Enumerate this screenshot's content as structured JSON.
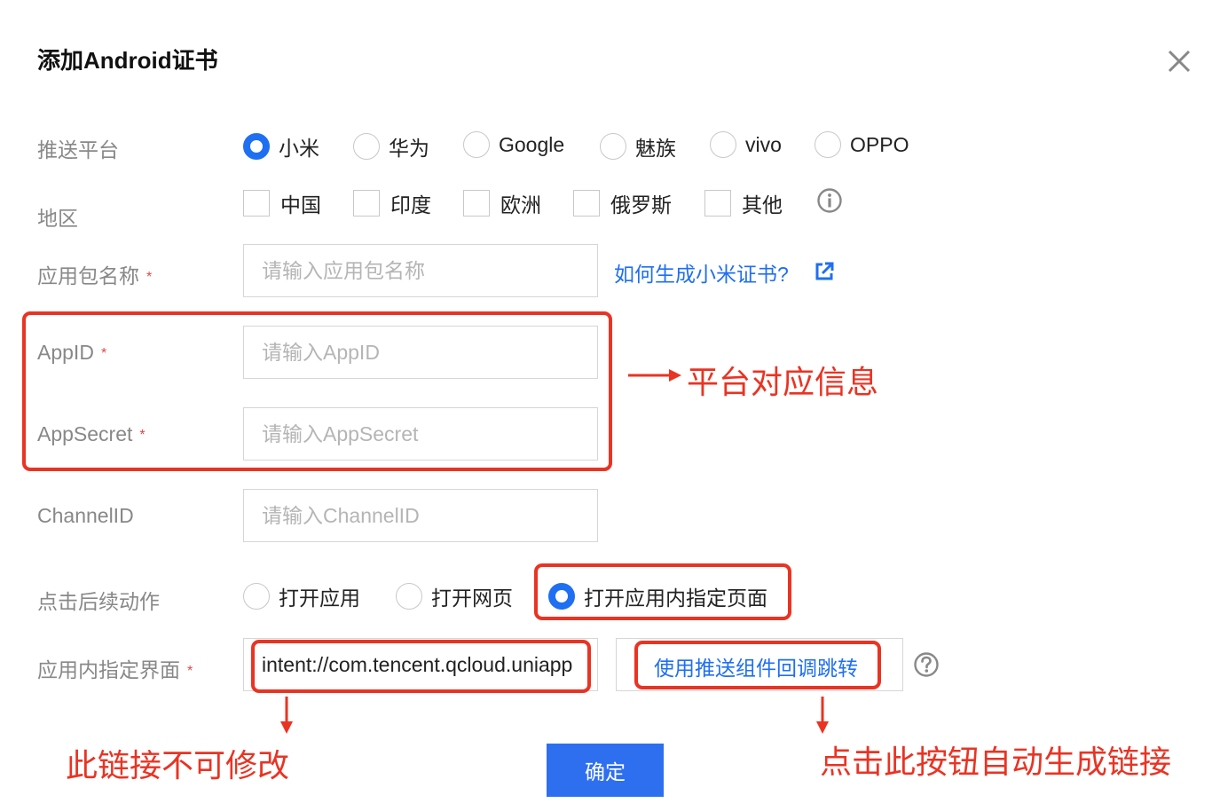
{
  "dialog": {
    "title": "添加Android证书",
    "close_icon": "close-icon"
  },
  "form": {
    "platform": {
      "label": "推送平台",
      "options": [
        "小米",
        "华为",
        "Google",
        "魅族",
        "vivo",
        "OPPO"
      ],
      "selected": "小米"
    },
    "region": {
      "label": "地区",
      "options": [
        "中国",
        "印度",
        "欧洲",
        "俄罗斯",
        "其他"
      ],
      "info_icon": "info-icon"
    },
    "package_name": {
      "label": "应用包名称",
      "placeholder": "请输入应用包名称",
      "value": "",
      "help_link": "如何生成小米证书?",
      "link_icon": "external-link-icon"
    },
    "app_id": {
      "label": "AppID",
      "placeholder": "请输入AppID",
      "value": ""
    },
    "app_secret": {
      "label": "AppSecret",
      "placeholder": "请输入AppSecret",
      "value": ""
    },
    "channel_id": {
      "label": "ChannelID",
      "placeholder": "请输入ChannelID",
      "value": ""
    },
    "click_action": {
      "label": "点击后续动作",
      "options": [
        "打开应用",
        "打开网页",
        "打开应用内指定页面"
      ],
      "selected": "打开应用内指定页面"
    },
    "intent_page": {
      "label": "应用内指定界面",
      "value": "intent://com.tencent.qcloud.uniapp",
      "button_label": "使用推送组件回调跳转",
      "help_icon": "question-icon"
    },
    "required_mark": "*",
    "confirm_label": "确定"
  },
  "annotations": {
    "platform_info": "平台对应信息",
    "link_readonly": "此链接不可修改",
    "auto_generate": "点击此按钮自动生成链接",
    "color": "#ea3323"
  },
  "colors": {
    "accent": "#1f6ff2",
    "primary_button": "#2e6ff0",
    "annotation": "#ea3323"
  }
}
